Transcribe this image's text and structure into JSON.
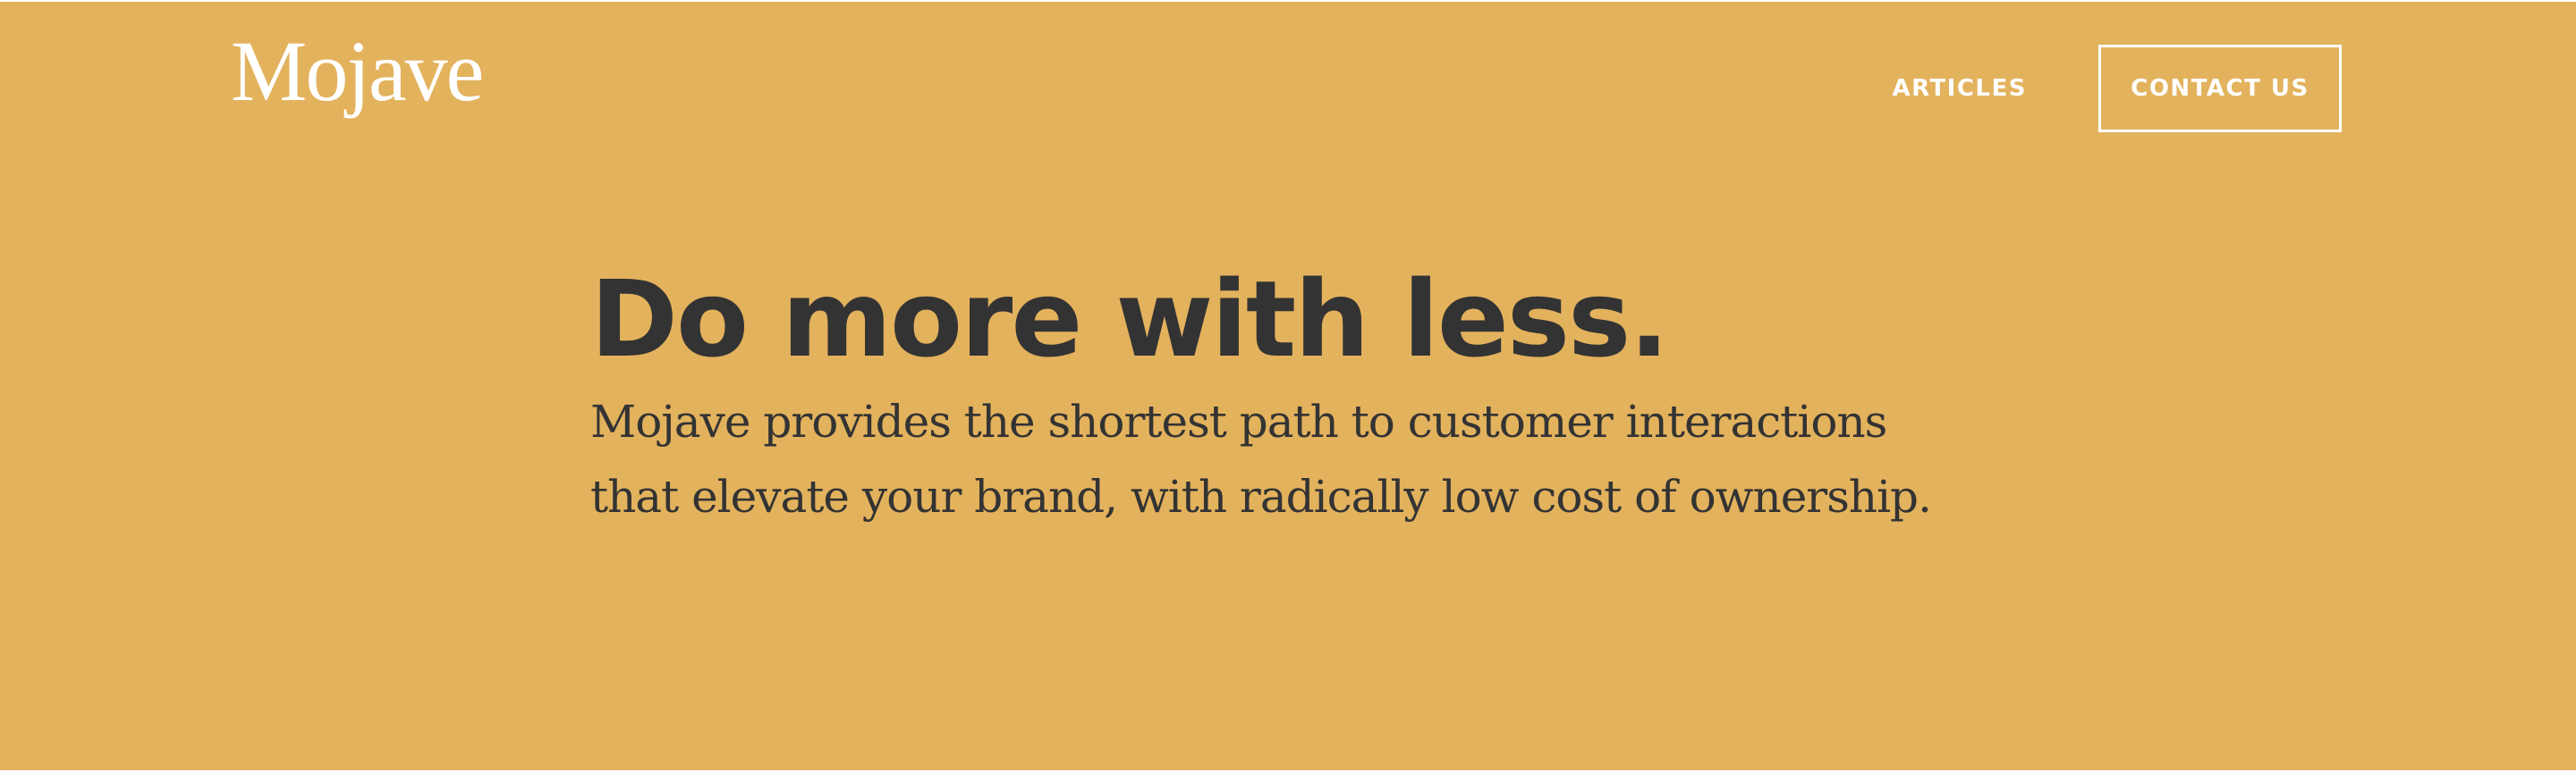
{
  "header": {
    "logo": "Mojave",
    "nav": {
      "articles_label": "ARTICLES",
      "contact_label": "CONTACT US"
    }
  },
  "hero": {
    "title": "Do more with less.",
    "body": "Mojave provides the shortest path to customer interactions that elevate your brand, with radically low cost of ownership."
  },
  "colors": {
    "background": "#E3B25D",
    "text": "#333333",
    "header_text": "#FFFFFF"
  }
}
